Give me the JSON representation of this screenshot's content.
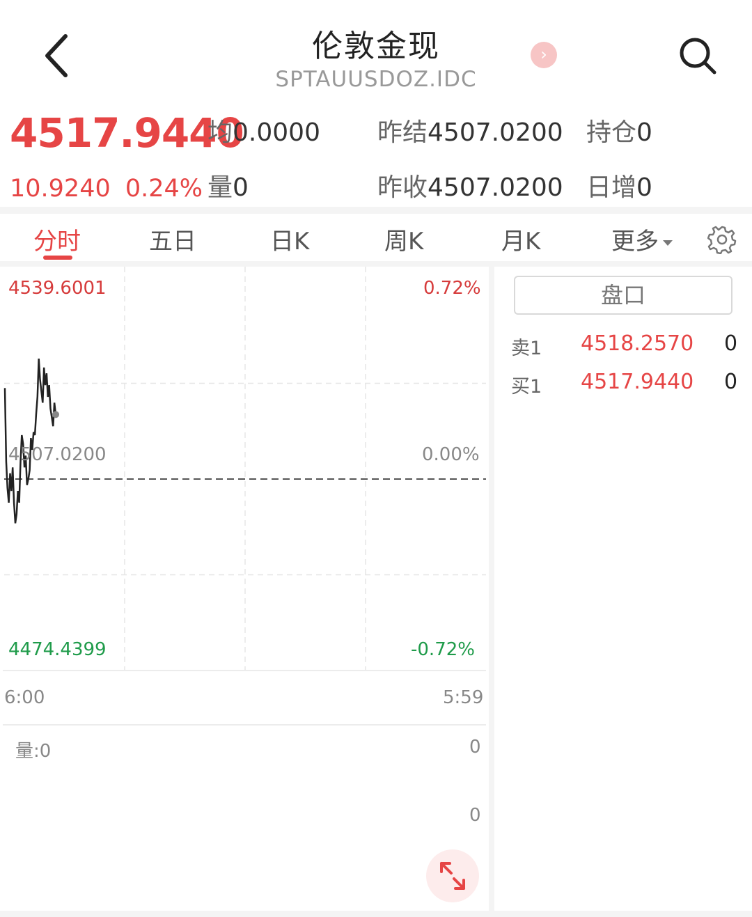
{
  "header": {
    "title": "伦敦金现",
    "subtitle": "SPTAUUSDOZ.IDC",
    "back_icon": "chevron-left-icon",
    "next_icon": "chevron-right-icon",
    "search_icon": "search-icon"
  },
  "quote": {
    "price": "4517.9440",
    "change": "10.9240",
    "change_pct": "0.24%",
    "avg_label": "均",
    "avg_value": "0.0000",
    "vol_label": "量",
    "vol_value": "0",
    "prev_settle_label": "昨结",
    "prev_settle_value": "4507.0200",
    "prev_close_label": "昨收",
    "prev_close_value": "4507.0200",
    "open_interest_label": "持仓",
    "open_interest_value": "0",
    "daily_increase_label": "日增",
    "daily_increase_value": "0"
  },
  "tabs": [
    {
      "label": "分时",
      "active": true
    },
    {
      "label": "五日",
      "active": false
    },
    {
      "label": "日K",
      "active": false
    },
    {
      "label": "周K",
      "active": false
    },
    {
      "label": "月K",
      "active": false
    },
    {
      "label": "更多",
      "active": false
    }
  ],
  "settings_icon": "gear-icon",
  "chart": {
    "top_price": "4539.6001",
    "top_pct": "0.72%",
    "mid_price": "4507.0200",
    "mid_pct": "0.00%",
    "bottom_price": "4474.4399",
    "bottom_pct": "-0.72%",
    "time_start": "6:00",
    "time_end": "5:59",
    "volume_label": "量:0",
    "volume_axis_top": "0",
    "volume_axis_bottom": "0",
    "expand_icon": "expand-icon"
  },
  "chart_data": {
    "type": "line",
    "ylim": [
      4474.4399,
      4539.6001
    ],
    "baseline": 4507.02,
    "y": [
      4522.5,
      4510,
      4505.5,
      4503,
      4508,
      4505,
      4509,
      4503,
      4499.5,
      4501,
      4505,
      4503,
      4510,
      4514.5,
      4513,
      4509,
      4511,
      4506,
      4507,
      4508.5,
      4514,
      4512,
      4515,
      4514.5,
      4518,
      4521,
      4527.5,
      4524,
      4522,
      4520,
      4526,
      4523,
      4525,
      4521,
      4523,
      4519,
      4517.5,
      4516,
      4520,
      4518
    ]
  },
  "orderbook": {
    "button_label": "盘口",
    "rows": [
      {
        "label": "卖1",
        "price": "4518.2570",
        "volume": "0"
      },
      {
        "label": "买1",
        "price": "4517.9440",
        "volume": "0"
      }
    ]
  },
  "colors": {
    "up": "#e64545",
    "down": "#1f9b4a",
    "line": "#222222"
  }
}
